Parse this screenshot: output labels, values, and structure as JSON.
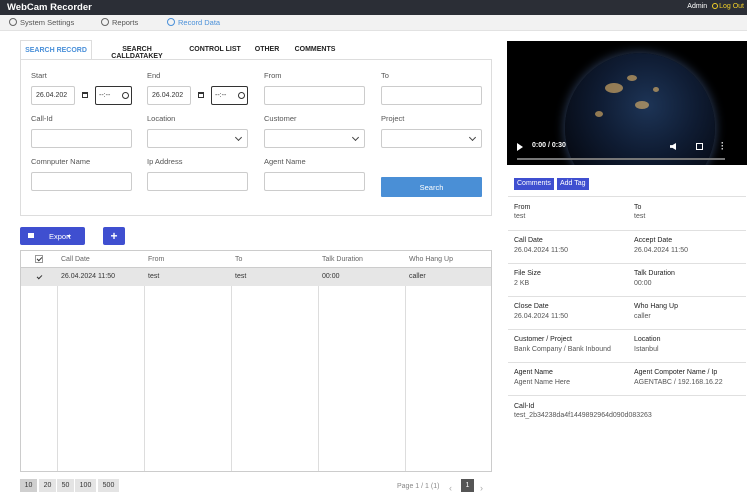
{
  "app": {
    "title": "WebCam Recorder",
    "user": "Admin",
    "logout": "Log Out"
  },
  "menu": {
    "system_settings": "System Settings",
    "reports": "Reports",
    "record_data": "Record Data"
  },
  "tabs": [
    "SEARCH RECORD",
    "SEARCH CALLDATAKEY",
    "CONTROL LIST",
    "OTHER",
    "COMMENTS"
  ],
  "search": {
    "start_label": "Start",
    "start_date": "26.04.202",
    "start_time": "--:--",
    "end_label": "End",
    "end_date": "26.04.202",
    "end_time": "--:--",
    "from_label": "From",
    "to_label": "To",
    "callid_label": "Call-Id",
    "location_label": "Location",
    "customer_label": "Customer",
    "project_label": "Project",
    "computer_label": "Comnputer Name",
    "ip_label": "Ip Address",
    "agent_label": "Agent Name",
    "search_button": "Search"
  },
  "toolbar": {
    "export": "Export",
    "add": "+"
  },
  "grid": {
    "columns": [
      "Call Date",
      "From",
      "To",
      "Talk Duration",
      "Who Hang Up"
    ],
    "rows": [
      {
        "call_date": "26.04.2024 11:50",
        "from": "test",
        "to": "test",
        "talk_duration": "00:00",
        "who_hang_up": "caller"
      }
    ]
  },
  "pager": {
    "sizes": [
      "10",
      "20",
      "50",
      "100",
      "500"
    ],
    "selected_size": "10",
    "info": "Page 1 / 1 (1)",
    "prev": "‹",
    "next": "›",
    "current": "1"
  },
  "video": {
    "time": "0:00 / 0:30",
    "progress": 0.0
  },
  "detail_buttons": {
    "comments": "Comments",
    "add_tag": "Add Tag"
  },
  "details": {
    "from_label": "From",
    "from_value": "test",
    "to_label": "To",
    "to_value": "test",
    "call_date_label": "Call Date",
    "call_date_value": "26.04.2024 11:50",
    "accept_date_label": "Accept Date",
    "accept_date_value": "26.04.2024 11:50",
    "file_size_label": "File Size",
    "file_size_value": "2 KB",
    "talk_duration_label": "Talk Duration",
    "talk_duration_value": "00:00",
    "close_date_label": "Close Date",
    "close_date_value": "26.04.2024 11:50",
    "who_hang_up_label": "Who Hang Up",
    "who_hang_up_value": "caller",
    "customer_project_label": "Customer / Project",
    "customer_project_value": "Bank Company / Bank Inbound",
    "location_label": "Location",
    "location_value": "Istanbul",
    "agent_name_label": "Agent Name",
    "agent_name_value": "Agent Name Here",
    "agent_computer_label": "Agent Compoter Name / Ip",
    "agent_computer_value": "AGENTABC / 192.168.16.22",
    "call_id_label": "Call-Id",
    "call_id_value": "test_2b34238da4f1449892964d090d083263"
  },
  "colors": {
    "accent_blue": "#4a90d9",
    "button_blue": "#3f4fd0",
    "topbar": "#2b2e36",
    "logout": "#f2d027"
  }
}
